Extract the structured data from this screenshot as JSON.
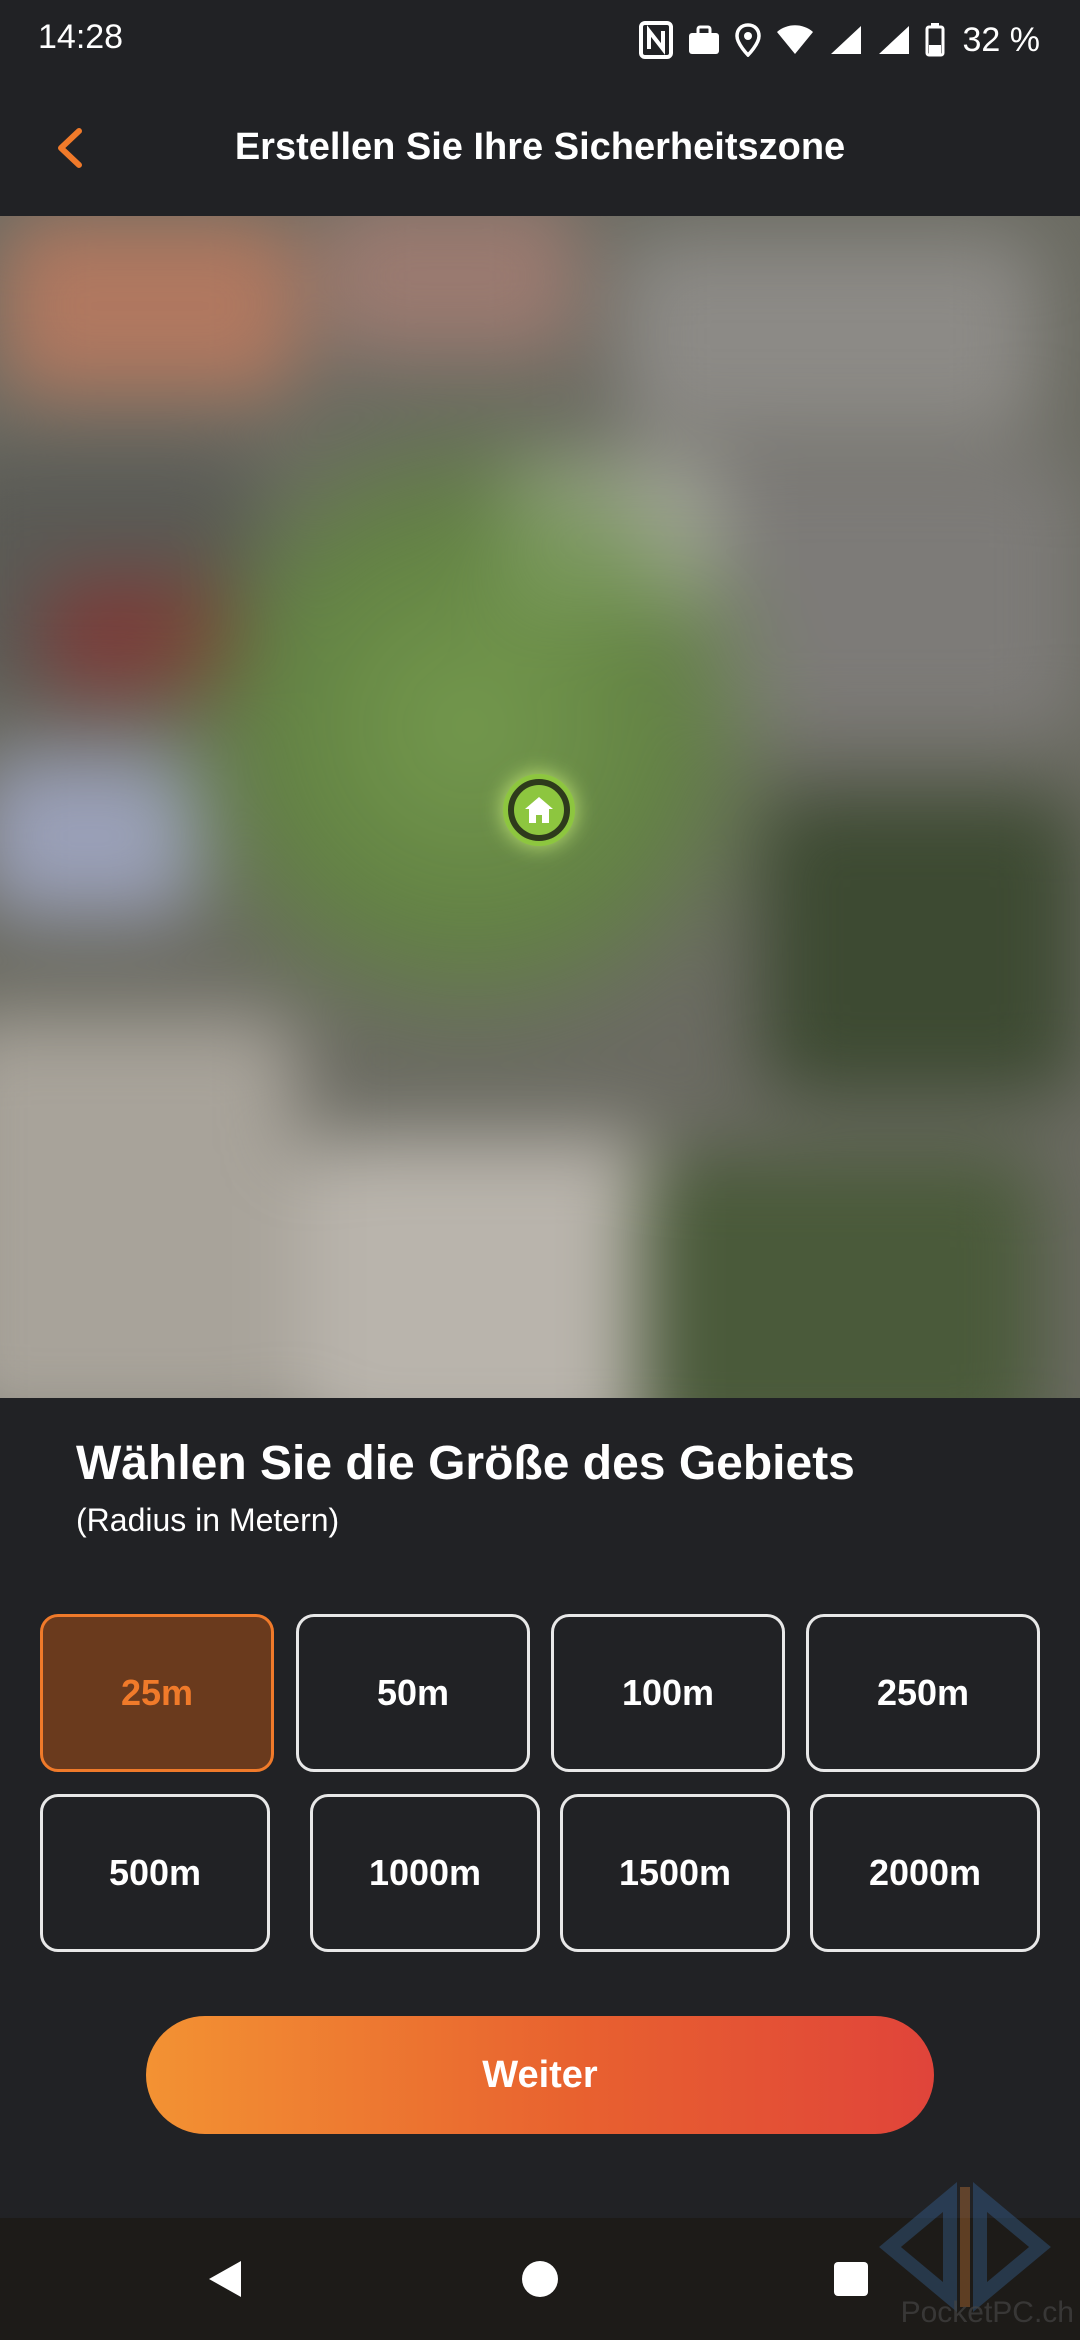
{
  "status_bar": {
    "time": "14:28",
    "battery": "32 %",
    "icons": [
      "nfc-icon",
      "briefcase-icon",
      "location-icon",
      "wifi-icon",
      "signal-icon",
      "signal-icon",
      "battery-icon"
    ]
  },
  "header": {
    "title": "Erstellen Sie Ihre Sicherheitszone",
    "back_icon": "chevron-left-icon",
    "accent": "#f07a2a"
  },
  "map": {
    "marker_icon": "home-icon",
    "zone_color": "#8dc63f"
  },
  "sheet": {
    "title": "Wählen Sie die Größe des Gebiets",
    "subtitle": "(Radius in Metern)",
    "options": [
      "25m",
      "50m",
      "100m",
      "250m",
      "500m",
      "1000m",
      "1500m",
      "2000m"
    ],
    "selected": "25m",
    "continue_label": "Weiter"
  },
  "nav": {
    "back": "back-triangle-icon",
    "home": "home-circle-icon",
    "recents": "recents-square-icon"
  },
  "watermark": "PocketPC.ch"
}
